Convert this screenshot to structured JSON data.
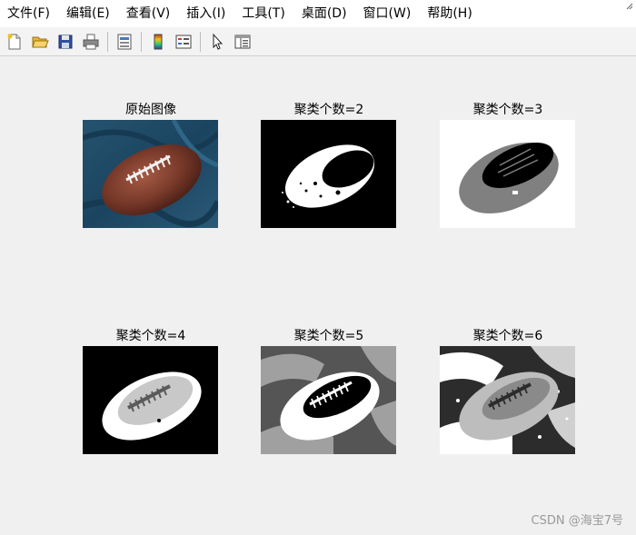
{
  "menu": {
    "file": "文件(F)",
    "edit": "编辑(E)",
    "view": "查看(V)",
    "insert": "插入(I)",
    "tools": "工具(T)",
    "desktop": "桌面(D)",
    "window": "窗口(W)",
    "help": "帮助(H)"
  },
  "toolbar": {
    "icons": [
      "new-file-icon",
      "open-folder-icon",
      "save-icon",
      "print-icon",
      "print-preview-icon",
      "insert-colorbar-icon",
      "insert-legend-icon",
      "select-pointer-icon",
      "property-editor-icon"
    ]
  },
  "panels": [
    {
      "title": "原始图像",
      "clusters": 0
    },
    {
      "title": "聚类个数=2",
      "clusters": 2
    },
    {
      "title": "聚类个数=3",
      "clusters": 3
    },
    {
      "title": "聚类个数=4",
      "clusters": 4
    },
    {
      "title": "聚类个数=5",
      "clusters": 5
    },
    {
      "title": "聚类个数=6",
      "clusters": 6
    }
  ],
  "watermark": "CSDN @海宝7号",
  "colors": {
    "figure_bg": "#f0f0f0",
    "cloth_blue": "#1f4d6b",
    "ball_brown": "#7a3a2a"
  }
}
